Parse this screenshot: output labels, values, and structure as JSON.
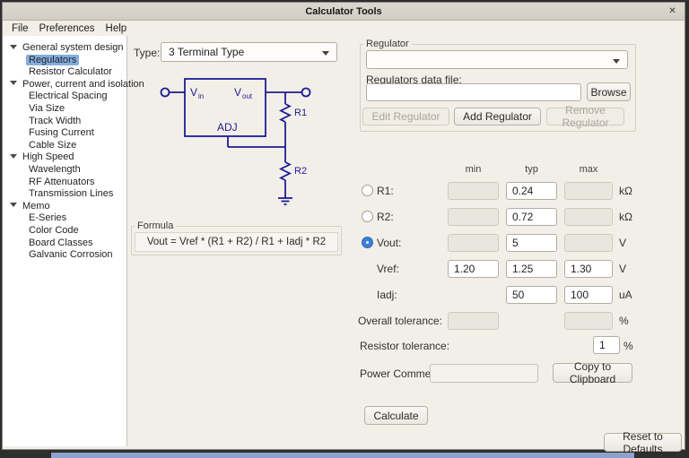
{
  "window": {
    "title": "Calculator Tools",
    "close_icon": "✕"
  },
  "menubar": {
    "file": "File",
    "preferences": "Preferences",
    "help": "Help"
  },
  "sidebar": {
    "sections": [
      {
        "label": "General system design",
        "items": [
          {
            "label": "Regulators",
            "selected": true
          },
          {
            "label": "Resistor Calculator",
            "selected": false
          }
        ]
      },
      {
        "label": "Power, current and isolation",
        "items": [
          {
            "label": "Electrical Spacing"
          },
          {
            "label": "Via Size"
          },
          {
            "label": "Track Width"
          },
          {
            "label": "Fusing Current"
          },
          {
            "label": "Cable Size"
          }
        ]
      },
      {
        "label": "High Speed",
        "items": [
          {
            "label": "Wavelength"
          },
          {
            "label": "RF Attenuators"
          },
          {
            "label": "Transmission Lines"
          }
        ]
      },
      {
        "label": "Memo",
        "items": [
          {
            "label": "E-Series"
          },
          {
            "label": "Color Code"
          },
          {
            "label": "Board Classes"
          },
          {
            "label": "Galvanic Corrosion"
          }
        ]
      }
    ]
  },
  "type_selector": {
    "label": "Type:",
    "value": "3 Terminal Type"
  },
  "diagram": {
    "line_color": "#1d1d93",
    "vin_main": "V",
    "vin_sub": "in",
    "vout_main": "V",
    "vout_sub": "out",
    "adj": "ADJ",
    "r1": "R1",
    "r2": "R2"
  },
  "formula": {
    "title": "Formula",
    "text": "Vout = Vref * (R1 + R2) / R1 + Iadj * R2"
  },
  "regulator": {
    "title": "Regulator",
    "combo_value": "",
    "data_file_label": "Regulators data file:",
    "data_file_value": "",
    "browse_label": "Browse",
    "edit_label": "Edit Regulator",
    "add_label": "Add Regulator",
    "remove_label": "Remove Regulator"
  },
  "params": {
    "headers": {
      "min": "min",
      "typ": "typ",
      "max": "max"
    },
    "r1": {
      "label": "R1:",
      "radio": "unchecked",
      "typ": "0.24",
      "unit": "kΩ"
    },
    "r2": {
      "label": "R2:",
      "radio": "unchecked",
      "typ": "0.72",
      "unit": "kΩ"
    },
    "vout": {
      "label": "Vout:",
      "radio": "checked",
      "typ": "5",
      "unit": "V"
    },
    "vref": {
      "label": "Vref:",
      "min": "1.20",
      "typ": "1.25",
      "max": "1.30",
      "unit": "V"
    },
    "iadj": {
      "label": "Iadj:",
      "typ": "50",
      "max": "100",
      "unit": "uA"
    },
    "overall": {
      "label": "Overall tolerance:",
      "unit": "%"
    },
    "resistor_tolerance": {
      "label": "Resistor tolerance:",
      "value": "1",
      "unit": "%"
    },
    "power_comment": {
      "label": "Power Comment:",
      "value": "",
      "button_label": "Copy to Clipboard"
    },
    "calculate_label": "Calculate"
  },
  "footer": {
    "reset_label": "Reset to Defaults"
  }
}
